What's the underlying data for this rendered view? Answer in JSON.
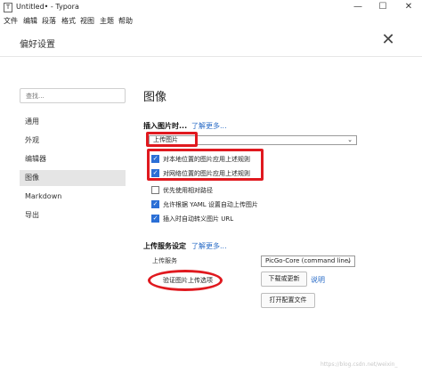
{
  "window": {
    "app_icon": "T",
    "title": "Untitled• - Typora",
    "controls": {
      "minimize": "—",
      "maximize": "☐",
      "close": "✕"
    }
  },
  "menubar": [
    "文件",
    "编辑",
    "段落",
    "格式",
    "视图",
    "主题",
    "帮助"
  ],
  "preferences": {
    "title": "偏好设置",
    "close_glyph": "✕"
  },
  "sidebar": {
    "search_placeholder": "查找...",
    "items": [
      {
        "label": "通用",
        "active": false
      },
      {
        "label": "外观",
        "active": false
      },
      {
        "label": "编辑器",
        "active": false
      },
      {
        "label": "图像",
        "active": true
      },
      {
        "label": "Markdown",
        "active": false
      },
      {
        "label": "导出",
        "active": false
      }
    ]
  },
  "image_section": {
    "title": "图像",
    "insert_label": "插入图片时...",
    "learn_more": "了解更多...",
    "insert_action": "上传图片",
    "dropdown_chevron": "⌄",
    "options": [
      {
        "label": "对本地位置的图片应用上述规则",
        "checked": true
      },
      {
        "label": "对网络位置的图片应用上述规则",
        "checked": true
      },
      {
        "label": "优先使用相对路径",
        "checked": false
      },
      {
        "label": "允许根据 YAML 设置自动上传图片",
        "checked": true
      },
      {
        "label": "插入时自动转义图片 URL",
        "checked": true
      }
    ]
  },
  "upload_section": {
    "title": "上传服务设定",
    "learn_more": "了解更多...",
    "service_label": "上传服务",
    "service_value": "PicGo-Core (command line)",
    "verify_button": "验证图片上传选项",
    "download_button": "下载或更新",
    "help_link": "说明",
    "open_config_button": "打开配置文件"
  },
  "watermark": "https://blog.csdn.net/weixin_",
  "colors": {
    "accent_blue": "#2b6fd6",
    "annotation_red": "#e0191f",
    "link_blue": "#2a6cc7",
    "active_nav_bg": "#e5e5e5"
  }
}
